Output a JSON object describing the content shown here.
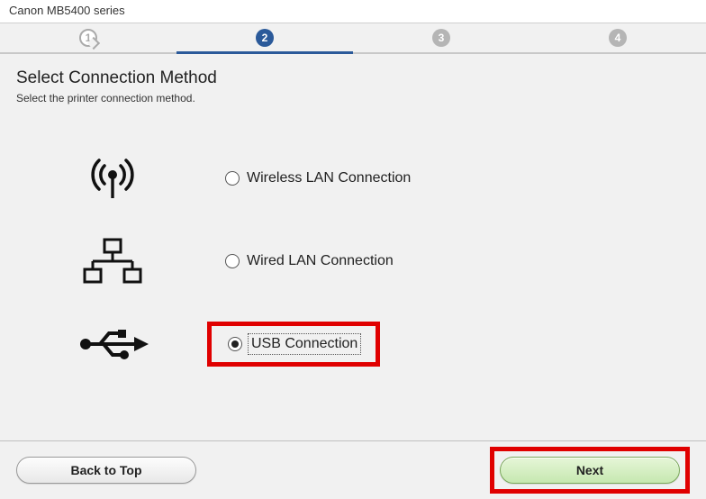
{
  "window": {
    "title": "Canon MB5400 series"
  },
  "steps": {
    "items": [
      {
        "num": "1",
        "state": "past"
      },
      {
        "num": "2",
        "state": "active"
      },
      {
        "num": "3",
        "state": "future"
      },
      {
        "num": "4",
        "state": "future"
      }
    ]
  },
  "header": {
    "title": "Select Connection Method",
    "subtitle": "Select the printer connection method."
  },
  "options": {
    "wireless": {
      "label": "Wireless LAN Connection",
      "checked": false
    },
    "wired": {
      "label": "Wired LAN Connection",
      "checked": false
    },
    "usb": {
      "label": "USB Connection",
      "checked": true
    }
  },
  "footer": {
    "back_label": "Back to Top",
    "next_label": "Next"
  },
  "highlights": {
    "usb": true,
    "next": true
  }
}
